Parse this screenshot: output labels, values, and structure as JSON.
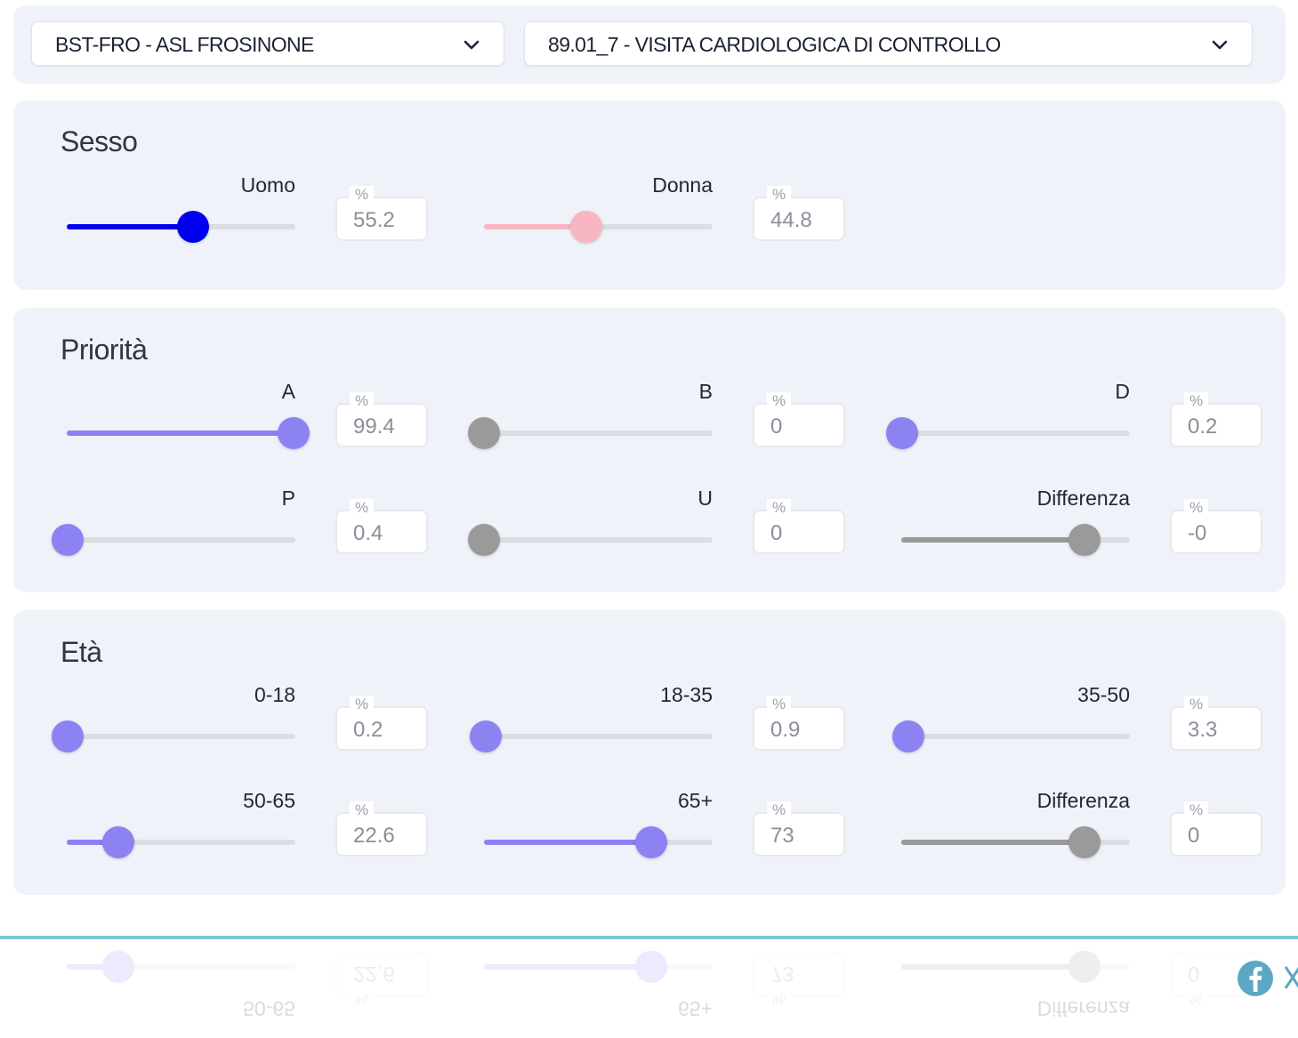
{
  "selectors": {
    "asl": "BST-FRO - ASL FROSINONE",
    "visita": "89.01_7 - VISITA CARDIOLOGICA DI CONTROLLO"
  },
  "percent_symbol": "%",
  "colors": {
    "panel_bg": "#eff2f8",
    "uomo": "#0000ee",
    "donna": "#f7b6c2",
    "accent": "#8c82f1",
    "neutral": "#9a9a9a",
    "footer_line": "#7ec7cf",
    "facebook": "#5ba7c4"
  },
  "sesso": {
    "title": "Sesso",
    "sliders": [
      {
        "label": "Uomo",
        "value": "55.2",
        "fraction": 0.552,
        "color": "#0000ee"
      },
      {
        "label": "Donna",
        "value": "44.8",
        "fraction": 0.448,
        "color": "#f7b6c2"
      }
    ]
  },
  "priorita": {
    "title": "Priorità",
    "sliders": [
      {
        "label": "A",
        "value": "99.4",
        "fraction": 0.994,
        "color": "#8c82f1"
      },
      {
        "label": "B",
        "value": "0",
        "fraction": 0.0,
        "color": "#9a9a9a"
      },
      {
        "label": "D",
        "value": "0.2",
        "fraction": 0.002,
        "color": "#8c82f1"
      },
      {
        "label": "P",
        "value": "0.4",
        "fraction": 0.004,
        "color": "#8c82f1"
      },
      {
        "label": "U",
        "value": "0",
        "fraction": 0.0,
        "color": "#9a9a9a"
      },
      {
        "label": "Differenza",
        "value": "-0",
        "fraction": 0.8,
        "color": "#9a9a9a"
      }
    ]
  },
  "eta": {
    "title": "Età",
    "sliders": [
      {
        "label": "0-18",
        "value": "0.2",
        "fraction": 0.002,
        "color": "#8c82f1"
      },
      {
        "label": "18-35",
        "value": "0.9",
        "fraction": 0.009,
        "color": "#8c82f1"
      },
      {
        "label": "35-50",
        "value": "3.3",
        "fraction": 0.033,
        "color": "#8c82f1"
      },
      {
        "label": "50-65",
        "value": "22.6",
        "fraction": 0.226,
        "color": "#8c82f1"
      },
      {
        "label": "65+",
        "value": "73",
        "fraction": 0.73,
        "color": "#8c82f1"
      },
      {
        "label": "Differenza",
        "value": "0",
        "fraction": 0.8,
        "color": "#9a9a9a"
      }
    ]
  },
  "icons": {
    "dropdown": "chevron-down-icon",
    "social_1": "facebook-icon",
    "social_2": "x-twitter-icon"
  }
}
